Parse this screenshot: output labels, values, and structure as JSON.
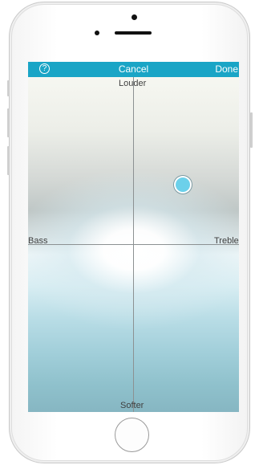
{
  "navbar": {
    "help_icon_glyph": "?",
    "cancel_label": "Cancel",
    "done_label": "Done",
    "color": "#1aa5c6"
  },
  "eq_pad": {
    "top_label": "Louder",
    "bottom_label": "Softer",
    "left_label": "Bass",
    "right_label": "Treble",
    "knob_color": "#6cd0ea"
  }
}
